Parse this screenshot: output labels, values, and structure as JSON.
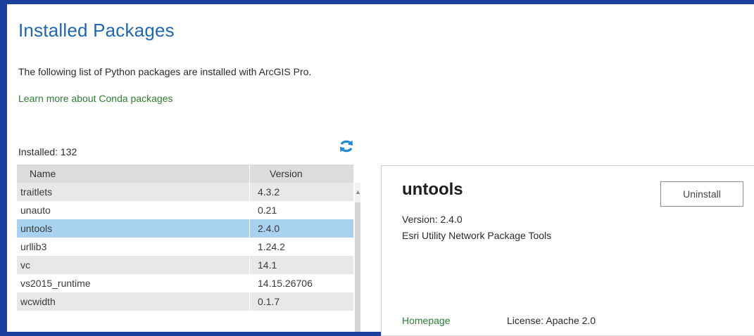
{
  "page": {
    "title": "Installed Packages",
    "intro": "The following list of Python packages are installed with ArcGIS Pro.",
    "learn_link": "Learn more about Conda packages",
    "installed_count": "Installed: 132",
    "refresh_icon": "refresh-icon"
  },
  "table": {
    "columns": [
      "Name",
      "Version"
    ],
    "rows": [
      {
        "name": "traitlets",
        "version": "4.3.2"
      },
      {
        "name": "unauto",
        "version": "0.21"
      },
      {
        "name": "untools",
        "version": "2.4.0"
      },
      {
        "name": "urllib3",
        "version": "1.24.2"
      },
      {
        "name": "vc",
        "version": "14.1"
      },
      {
        "name": "vs2015_runtime",
        "version": "14.15.26706"
      },
      {
        "name": "wcwidth",
        "version": "0.1.7"
      }
    ],
    "selected_index": 2
  },
  "details": {
    "name": "untools",
    "uninstall_label": "Uninstall",
    "version": "Version: 2.4.0",
    "description": "Esri Utility Network Package Tools",
    "homepage_label": "Homepage",
    "license": "License: Apache 2.0"
  },
  "colors": {
    "accent_blue": "#1f68b0",
    "link_green": "#2e7d32",
    "selected_row": "#a8d2f0",
    "background": "#1a3f9c"
  }
}
